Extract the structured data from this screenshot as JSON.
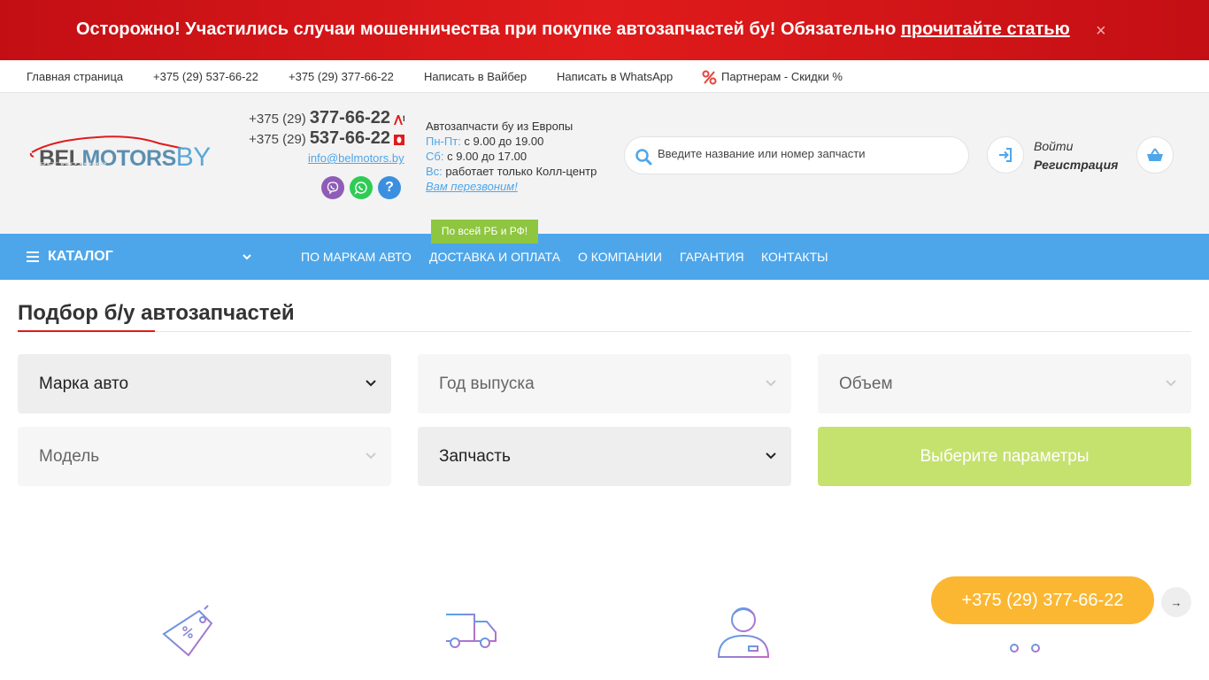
{
  "banner": {
    "text": "Осторожно! Участились случаи мошенничества при покупке автозапчастей бу! Обязательно ",
    "link": "прочитайте статью",
    "close": "×"
  },
  "topnav": {
    "home": "Главная страница",
    "phone1": "+375 (29) 537-66-22",
    "phone2": "+375 (29) 377-66-22",
    "viber": "Написать в Вайбер",
    "whatsapp": "Написать в WhatsApp",
    "partners": "Партнерам - Скидки %"
  },
  "logo": {
    "part1": "BEL",
    "part2": "MOTORS",
    "part3": "BY"
  },
  "contacts": {
    "phone_a": {
      "code": "+375 (29)",
      "number": "377-66-22"
    },
    "phone_b": {
      "code": "+375 (29)",
      "number": "537-66-22"
    },
    "email": "info@belmotors.by",
    "help": "?"
  },
  "hours": {
    "title": "Автозапчасти бу из Европы",
    "weekdays_label": "Пн-Пт:",
    "weekdays": "с 9.00 до 19.00",
    "sat_label": "Сб:",
    "sat": "с 9.00 до 17.00",
    "sun_label": "Вс:",
    "sun": "работает только Колл-центр",
    "callback": "Вам перезвоним!"
  },
  "search": {
    "placeholder": "Введите название или номер запчасти"
  },
  "account": {
    "login": "Войти",
    "register": "Регистрация"
  },
  "mainnav": {
    "catalog": "КАТАЛОГ",
    "brands": "ПО МАРКАМ АВТО",
    "delivery": "ДОСТАВКА И ОПЛАТА",
    "about": "О КОМПАНИИ",
    "warranty": "ГАРАНТИЯ",
    "contacts": "КОНТАКТЫ",
    "promo": "По всей РБ и РФ!"
  },
  "selector": {
    "title": "Подбор б/у автозапчастей",
    "make": "Марка авто",
    "year": "Год выпуска",
    "volume": "Объем",
    "model": "Модель",
    "part": "Запчасть",
    "submit": "Выберите параметры"
  },
  "floating": {
    "phone": "+375 (29) 377-66-22",
    "arrow": "→"
  },
  "colors": {
    "banner_red": "#e01b1b",
    "nav_blue": "#4ea6ea",
    "promo_green": "#8ec63f",
    "submit_green": "#c5e26f",
    "call_orange": "#fbb731"
  }
}
